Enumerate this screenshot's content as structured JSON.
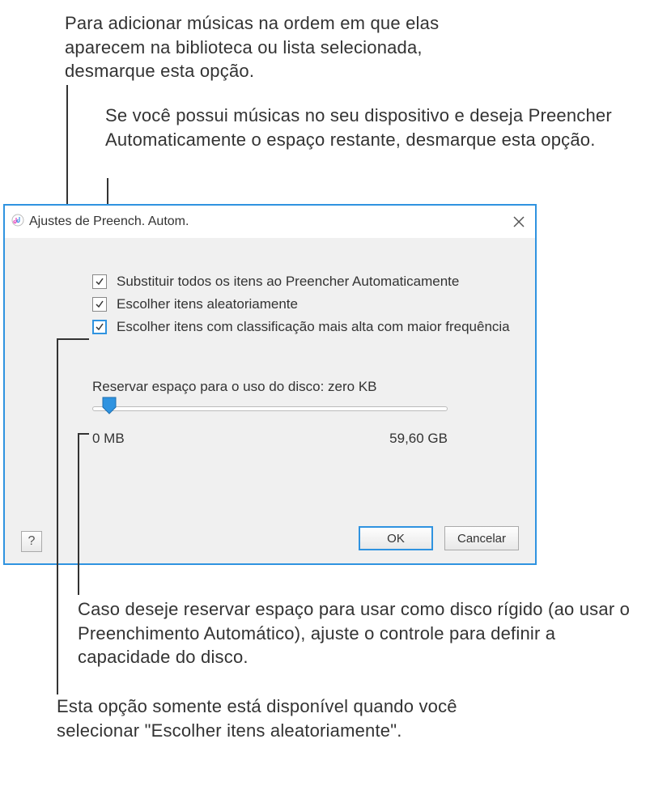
{
  "callouts": {
    "c1": "Para adicionar músicas na ordem em que elas aparecem na biblioteca ou lista selecionada, desmarque esta opção.",
    "c2": "Se você possui músicas no seu dispositivo e deseja Preencher Automaticamente o espaço restante, desmarque esta opção.",
    "c3": "Caso deseje reservar espaço para usar como disco rígido (ao usar o Preenchimento Automático), ajuste o controle para definir a capacidade do disco.",
    "c4": "Esta opção somente está disponível quando você selecionar \"Escolher itens aleatoriamente\"."
  },
  "dialog": {
    "title": "Ajustes de Preench. Autom.",
    "checks": {
      "replace": "Substituir todos os itens ao Preencher Automaticamente",
      "random": "Escolher itens aleatoriamente",
      "higher": "Escolher itens com classificação mais alta com maior frequência"
    },
    "reserve_label": "Reservar espaço para o uso do disco: zero KB",
    "slider": {
      "min_label": "0 MB",
      "max_label": "59,60 GB"
    },
    "buttons": {
      "ok": "OK",
      "cancel": "Cancelar",
      "help": "?"
    }
  }
}
